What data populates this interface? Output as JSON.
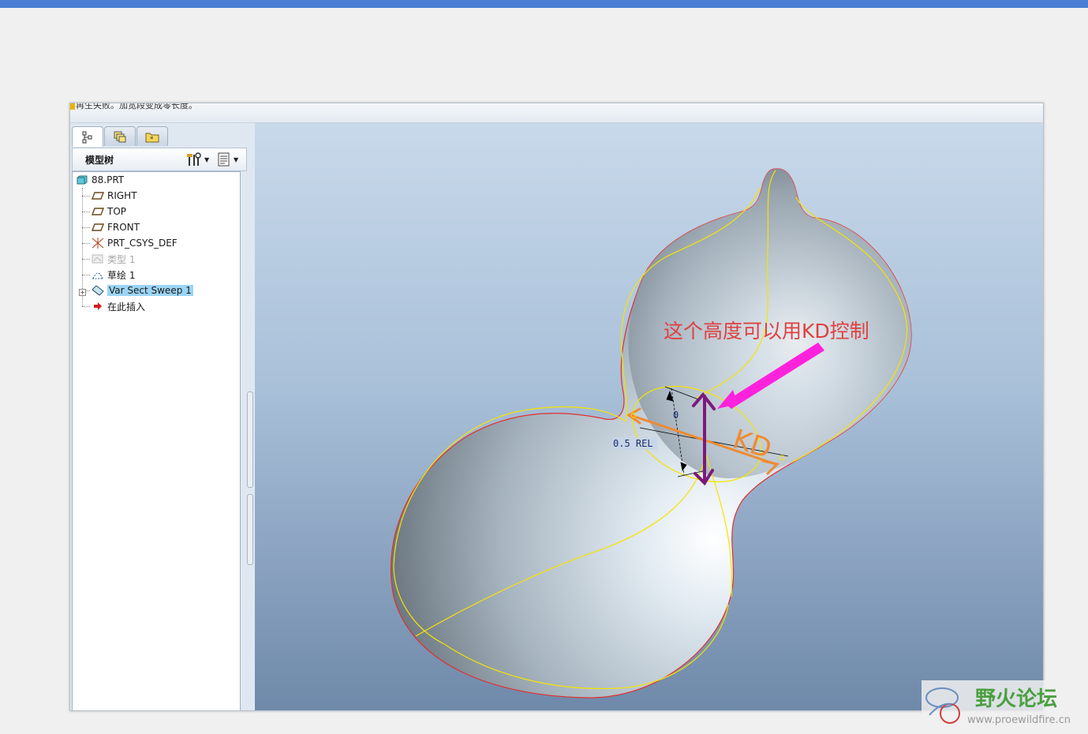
{
  "message_bar": {
    "text": "再生失败。加宽段变成零长度。"
  },
  "left_panel": {
    "tabs": [
      {
        "name": "model-tree",
        "icon": "model-tree-icon"
      },
      {
        "name": "layers",
        "icon": "layers-icon"
      },
      {
        "name": "favorites",
        "icon": "favorites-folder-icon"
      }
    ],
    "tree_title": "模型树",
    "settings_icon": "settings-tools-icon",
    "show_icon": "show-list-icon"
  },
  "model_tree": {
    "items": [
      {
        "label": "88.PRT",
        "icon": "part-icon"
      },
      {
        "label": "RIGHT",
        "icon": "datum-plane-icon"
      },
      {
        "label": "TOP",
        "icon": "datum-plane-icon"
      },
      {
        "label": "FRONT",
        "icon": "datum-plane-icon"
      },
      {
        "label": "PRT_CSYS_DEF",
        "icon": "csys-icon"
      },
      {
        "label": "类型 1",
        "icon": "suppressed-feature-icon"
      },
      {
        "label": "草绘 1",
        "icon": "sketch-icon"
      },
      {
        "label": "Var Sect Sweep 1",
        "icon": "var-sect-sweep-icon"
      },
      {
        "label": "在此插入",
        "icon": "insert-here-arrow-icon"
      }
    ]
  },
  "viewport": {
    "annotation": "这个高度可以用KD控制",
    "dim_zero": "0",
    "dim_rel": "0.5 REL",
    "handwritten": "KD",
    "colors": {
      "annotation_text": "#e04040",
      "pointer_arrow": "#ff22dd",
      "height_arrow": "#7a1a7a",
      "sketch_arrow": "#f08a30",
      "edge_lines": "#f5e400"
    }
  },
  "watermark": {
    "title": "野火论坛",
    "url": "www.proewildfire.cn"
  }
}
